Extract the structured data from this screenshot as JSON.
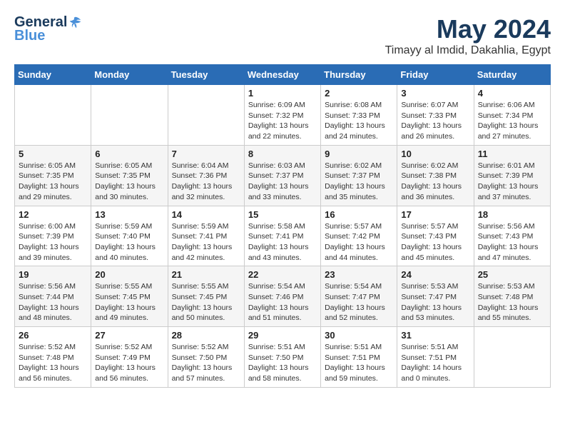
{
  "logo": {
    "general": "General",
    "blue": "Blue"
  },
  "title": "May 2024",
  "subtitle": "Timayy al Imdid, Dakahlia, Egypt",
  "days_of_week": [
    "Sunday",
    "Monday",
    "Tuesday",
    "Wednesday",
    "Thursday",
    "Friday",
    "Saturday"
  ],
  "weeks": [
    [
      {
        "day": "",
        "sunrise": "",
        "sunset": "",
        "daylight": ""
      },
      {
        "day": "",
        "sunrise": "",
        "sunset": "",
        "daylight": ""
      },
      {
        "day": "",
        "sunrise": "",
        "sunset": "",
        "daylight": ""
      },
      {
        "day": "1",
        "sunrise": "Sunrise: 6:09 AM",
        "sunset": "Sunset: 7:32 PM",
        "daylight": "Daylight: 13 hours and 22 minutes."
      },
      {
        "day": "2",
        "sunrise": "Sunrise: 6:08 AM",
        "sunset": "Sunset: 7:33 PM",
        "daylight": "Daylight: 13 hours and 24 minutes."
      },
      {
        "day": "3",
        "sunrise": "Sunrise: 6:07 AM",
        "sunset": "Sunset: 7:33 PM",
        "daylight": "Daylight: 13 hours and 26 minutes."
      },
      {
        "day": "4",
        "sunrise": "Sunrise: 6:06 AM",
        "sunset": "Sunset: 7:34 PM",
        "daylight": "Daylight: 13 hours and 27 minutes."
      }
    ],
    [
      {
        "day": "5",
        "sunrise": "Sunrise: 6:05 AM",
        "sunset": "Sunset: 7:35 PM",
        "daylight": "Daylight: 13 hours and 29 minutes."
      },
      {
        "day": "6",
        "sunrise": "Sunrise: 6:05 AM",
        "sunset": "Sunset: 7:35 PM",
        "daylight": "Daylight: 13 hours and 30 minutes."
      },
      {
        "day": "7",
        "sunrise": "Sunrise: 6:04 AM",
        "sunset": "Sunset: 7:36 PM",
        "daylight": "Daylight: 13 hours and 32 minutes."
      },
      {
        "day": "8",
        "sunrise": "Sunrise: 6:03 AM",
        "sunset": "Sunset: 7:37 PM",
        "daylight": "Daylight: 13 hours and 33 minutes."
      },
      {
        "day": "9",
        "sunrise": "Sunrise: 6:02 AM",
        "sunset": "Sunset: 7:37 PM",
        "daylight": "Daylight: 13 hours and 35 minutes."
      },
      {
        "day": "10",
        "sunrise": "Sunrise: 6:02 AM",
        "sunset": "Sunset: 7:38 PM",
        "daylight": "Daylight: 13 hours and 36 minutes."
      },
      {
        "day": "11",
        "sunrise": "Sunrise: 6:01 AM",
        "sunset": "Sunset: 7:39 PM",
        "daylight": "Daylight: 13 hours and 37 minutes."
      }
    ],
    [
      {
        "day": "12",
        "sunrise": "Sunrise: 6:00 AM",
        "sunset": "Sunset: 7:39 PM",
        "daylight": "Daylight: 13 hours and 39 minutes."
      },
      {
        "day": "13",
        "sunrise": "Sunrise: 5:59 AM",
        "sunset": "Sunset: 7:40 PM",
        "daylight": "Daylight: 13 hours and 40 minutes."
      },
      {
        "day": "14",
        "sunrise": "Sunrise: 5:59 AM",
        "sunset": "Sunset: 7:41 PM",
        "daylight": "Daylight: 13 hours and 42 minutes."
      },
      {
        "day": "15",
        "sunrise": "Sunrise: 5:58 AM",
        "sunset": "Sunset: 7:41 PM",
        "daylight": "Daylight: 13 hours and 43 minutes."
      },
      {
        "day": "16",
        "sunrise": "Sunrise: 5:57 AM",
        "sunset": "Sunset: 7:42 PM",
        "daylight": "Daylight: 13 hours and 44 minutes."
      },
      {
        "day": "17",
        "sunrise": "Sunrise: 5:57 AM",
        "sunset": "Sunset: 7:43 PM",
        "daylight": "Daylight: 13 hours and 45 minutes."
      },
      {
        "day": "18",
        "sunrise": "Sunrise: 5:56 AM",
        "sunset": "Sunset: 7:43 PM",
        "daylight": "Daylight: 13 hours and 47 minutes."
      }
    ],
    [
      {
        "day": "19",
        "sunrise": "Sunrise: 5:56 AM",
        "sunset": "Sunset: 7:44 PM",
        "daylight": "Daylight: 13 hours and 48 minutes."
      },
      {
        "day": "20",
        "sunrise": "Sunrise: 5:55 AM",
        "sunset": "Sunset: 7:45 PM",
        "daylight": "Daylight: 13 hours and 49 minutes."
      },
      {
        "day": "21",
        "sunrise": "Sunrise: 5:55 AM",
        "sunset": "Sunset: 7:45 PM",
        "daylight": "Daylight: 13 hours and 50 minutes."
      },
      {
        "day": "22",
        "sunrise": "Sunrise: 5:54 AM",
        "sunset": "Sunset: 7:46 PM",
        "daylight": "Daylight: 13 hours and 51 minutes."
      },
      {
        "day": "23",
        "sunrise": "Sunrise: 5:54 AM",
        "sunset": "Sunset: 7:47 PM",
        "daylight": "Daylight: 13 hours and 52 minutes."
      },
      {
        "day": "24",
        "sunrise": "Sunrise: 5:53 AM",
        "sunset": "Sunset: 7:47 PM",
        "daylight": "Daylight: 13 hours and 53 minutes."
      },
      {
        "day": "25",
        "sunrise": "Sunrise: 5:53 AM",
        "sunset": "Sunset: 7:48 PM",
        "daylight": "Daylight: 13 hours and 55 minutes."
      }
    ],
    [
      {
        "day": "26",
        "sunrise": "Sunrise: 5:52 AM",
        "sunset": "Sunset: 7:48 PM",
        "daylight": "Daylight: 13 hours and 56 minutes."
      },
      {
        "day": "27",
        "sunrise": "Sunrise: 5:52 AM",
        "sunset": "Sunset: 7:49 PM",
        "daylight": "Daylight: 13 hours and 56 minutes."
      },
      {
        "day": "28",
        "sunrise": "Sunrise: 5:52 AM",
        "sunset": "Sunset: 7:50 PM",
        "daylight": "Daylight: 13 hours and 57 minutes."
      },
      {
        "day": "29",
        "sunrise": "Sunrise: 5:51 AM",
        "sunset": "Sunset: 7:50 PM",
        "daylight": "Daylight: 13 hours and 58 minutes."
      },
      {
        "day": "30",
        "sunrise": "Sunrise: 5:51 AM",
        "sunset": "Sunset: 7:51 PM",
        "daylight": "Daylight: 13 hours and 59 minutes."
      },
      {
        "day": "31",
        "sunrise": "Sunrise: 5:51 AM",
        "sunset": "Sunset: 7:51 PM",
        "daylight": "Daylight: 14 hours and 0 minutes."
      },
      {
        "day": "",
        "sunrise": "",
        "sunset": "",
        "daylight": ""
      }
    ]
  ]
}
